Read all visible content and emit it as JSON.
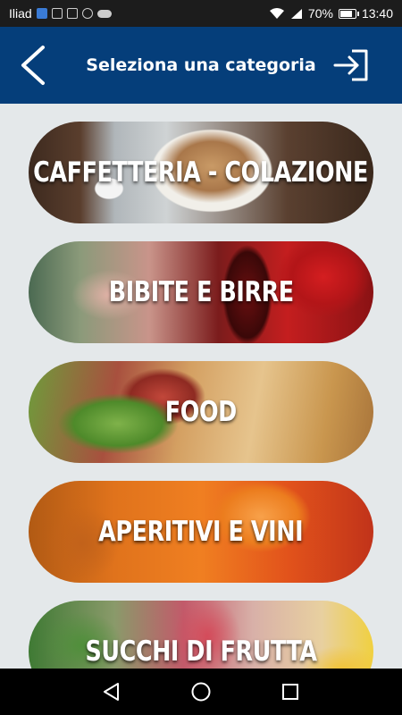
{
  "status_bar": {
    "carrier": "Iliad",
    "battery": "70%",
    "battery_level": 0.7,
    "time": "13:40"
  },
  "header": {
    "title": "Seleziona una categoria",
    "back_icon": "chevron-left-icon",
    "logout_icon": "logout-icon",
    "background_color": "#053e7a"
  },
  "categories": [
    {
      "label": "CAFFETTERIA - COLAZIONE",
      "image": "coffee-cup-photo"
    },
    {
      "label": "BIBITE E BIRRE",
      "image": "soft-drinks-photo"
    },
    {
      "label": "FOOD",
      "image": "sandwich-photo"
    },
    {
      "label": "APERITIVI E VINI",
      "image": "aperitif-photo"
    },
    {
      "label": "SUCCHI DI FRUTTA",
      "image": "fruit-juice-photo"
    }
  ],
  "nav_bar": {
    "back_icon": "triangle-back-icon",
    "home_icon": "circle-home-icon",
    "recent_icon": "square-recents-icon"
  }
}
